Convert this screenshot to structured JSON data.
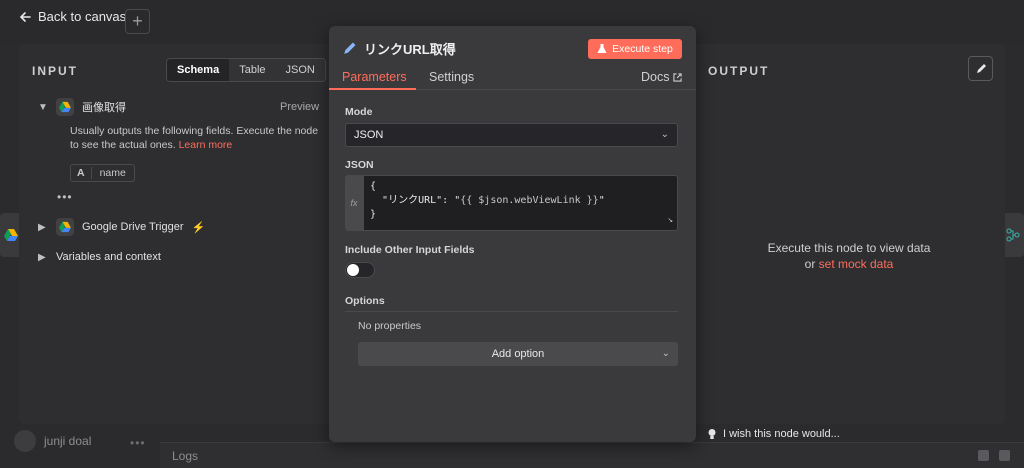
{
  "topbar": {
    "back_label": "Back to canvas",
    "plus_label": "+"
  },
  "input_panel": {
    "title": "INPUT",
    "view_tabs": [
      "Schema",
      "Table",
      "JSON"
    ],
    "active_view": "Schema",
    "preview_label": "Preview",
    "node1_name": "画像取得",
    "info_text": "Usually outputs the following fields. Execute the node to see the actual ones.",
    "learn_more": "Learn more",
    "field_type": "A",
    "field_name": "name",
    "dots": "•••",
    "node2_name": "Google Drive Trigger",
    "vars_label": "Variables and context"
  },
  "node": {
    "title": "リンクURL取得",
    "execute_label": "Execute step",
    "tabs": [
      "Parameters",
      "Settings"
    ],
    "active_tab": "Parameters",
    "docs_label": "Docs",
    "mode_label": "Mode",
    "mode_value": "JSON",
    "json_label": "JSON",
    "fx_label": "fx",
    "json_line1": "{",
    "json_key": "\"リンクURL\": \"",
    "json_expr": "{{ $json.webViewLink }}",
    "json_end": "\"",
    "json_line3": "}",
    "include_label": "Include Other Input Fields",
    "include_enabled": false,
    "options_label": "Options",
    "no_props": "No properties",
    "add_option": "Add option"
  },
  "output_panel": {
    "title": "OUTPUT",
    "msg_line1": "Execute this node to view data",
    "msg_or": "or",
    "msg_link": "set mock data",
    "wish_label": "I wish this node would..."
  },
  "footer": {
    "user_name": "junji doal",
    "menu": "•••",
    "logs_label": "Logs"
  },
  "colors": {
    "accent": "#ff6d5a",
    "panel": "#3a3a3d",
    "background": "#2b2b2d"
  }
}
